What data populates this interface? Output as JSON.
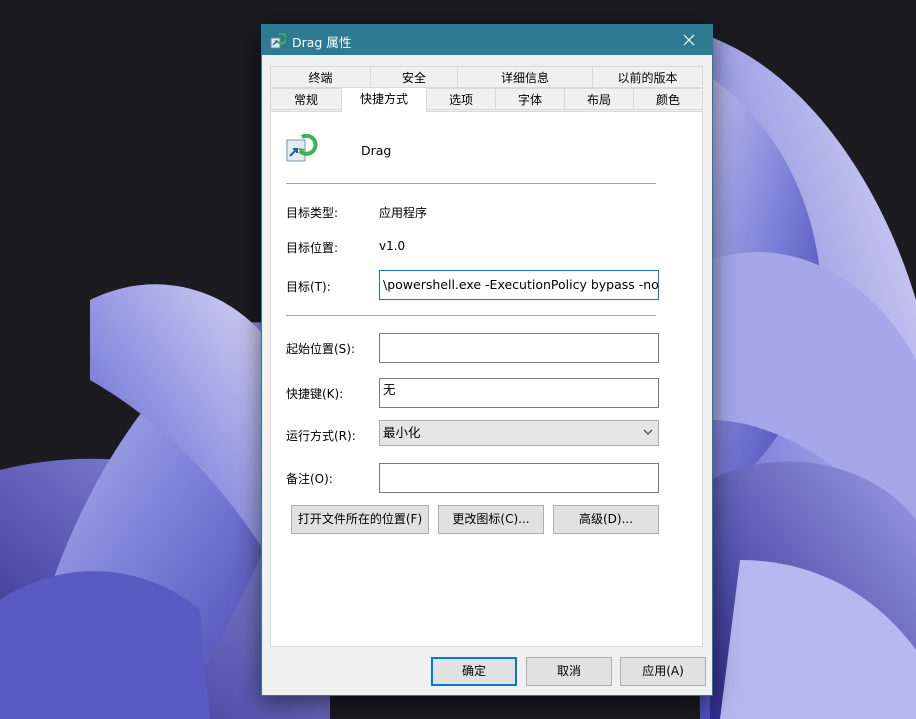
{
  "window": {
    "title": "Drag 属性"
  },
  "tabs_row1": [
    "终端",
    "安全",
    "详细信息",
    "以前的版本"
  ],
  "tabs_row2": [
    "常规",
    "快捷方式",
    "选项",
    "字体",
    "布局",
    "颜色"
  ],
  "active_tab": "快捷方式",
  "shortcut": {
    "name": "Drag",
    "target_type_label": "目标类型:",
    "target_type_value": "应用程序",
    "target_location_label": "目标位置:",
    "target_location_value": "v1.0",
    "target_label": "目标(T):",
    "target_value": "\\powershell.exe -ExecutionPolicy bypass -noprofile",
    "start_in_label": "起始位置(S):",
    "start_in_value": "",
    "hotkey_label": "快捷键(K):",
    "hotkey_value": "无",
    "run_label": "运行方式(R):",
    "run_value": "最小化",
    "comment_label": "备注(O):",
    "comment_value": "",
    "open_location_button": "打开文件所在的位置(F)",
    "change_icon_button": "更改图标(C)...",
    "advanced_button": "高级(D)..."
  },
  "footer": {
    "ok": "确定",
    "cancel": "取消",
    "apply": "应用(A)"
  },
  "colors": {
    "titlebar": "#2d7a93",
    "dialog_bg": "#f0f0f0",
    "focus_border": "#0078d7"
  }
}
